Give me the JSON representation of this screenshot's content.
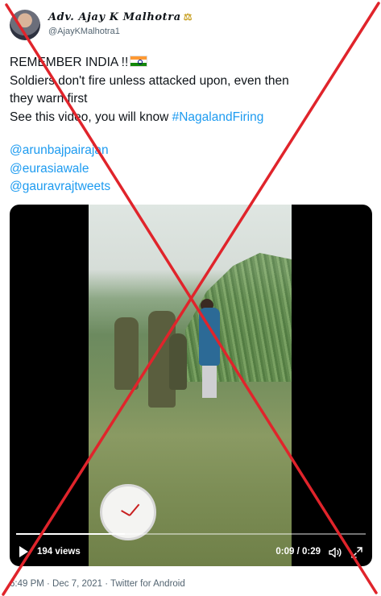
{
  "author": {
    "display_name": "Adv. Ajay K Malhotra",
    "name_emoji": "⚖",
    "handle": "@AjayKMalhotra1"
  },
  "tweet": {
    "line1": "REMEMBER INDIA !!",
    "flag_icon": "india-flag-icon",
    "line2": "Soldiers don't fire unless attacked upon, even then",
    "line3": "they warn first",
    "line4_text": "See this video, you will know ",
    "hashtag": "#NagalandFiring",
    "mentions": [
      "@arunbajpairajan",
      "@eurasiawale",
      "@gauravrajtweets"
    ]
  },
  "video": {
    "views": "194 views",
    "time": "0:09 / 0:29",
    "progress": 0.31,
    "play_icon": "play-icon",
    "volume_icon": "volume-icon",
    "fullscreen_icon": "fullscreen-icon"
  },
  "footer": {
    "meta": "6:49 PM · Dec 7, 2021 · Twitter for Android"
  },
  "overlay": {
    "cross_color": "#e0242b"
  },
  "colors": {
    "link": "#1d9bf0",
    "text": "#0f1419",
    "secondary": "#536471"
  }
}
